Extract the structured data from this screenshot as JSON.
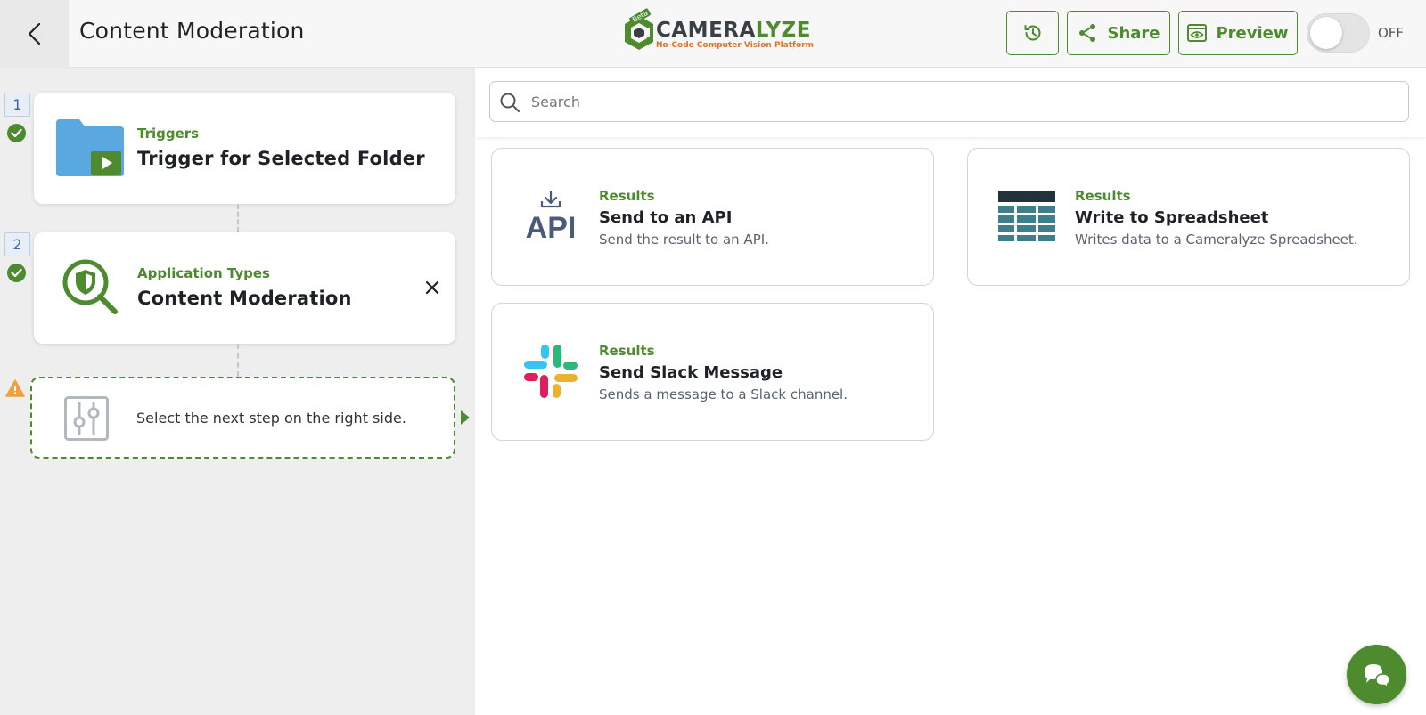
{
  "header": {
    "title": "Content Moderation",
    "logo": {
      "word_main": "CAMERA",
      "word_accent": "LYZE",
      "tagline": "No-Code Computer Vision Platform",
      "badge": "Beta"
    },
    "share_label": "Share",
    "preview_label": "Preview",
    "toggle_label": "OFF",
    "toggle_on": false
  },
  "steps": [
    {
      "number": "1",
      "category": "Triggers",
      "title": "Trigger for Selected Folder",
      "status": "complete"
    },
    {
      "number": "2",
      "category": "Application Types",
      "title": "Content Moderation",
      "status": "complete"
    }
  ],
  "pending_step": {
    "text": "Select the next step on the right side.",
    "status": "warning"
  },
  "search": {
    "placeholder": "Search",
    "value": ""
  },
  "results": [
    {
      "category": "Results",
      "title": "Send to an API",
      "description": "Send the result to an API.",
      "icon": "api-icon"
    },
    {
      "category": "Results",
      "title": "Write to Spreadsheet",
      "description": "Writes data to a Cameralyze Spreadsheet.",
      "icon": "spreadsheet-icon"
    },
    {
      "category": "Results",
      "title": "Send Slack Message",
      "description": "Sends a message to a Slack channel.",
      "icon": "slack-icon"
    }
  ],
  "icons": {
    "api_text": "API"
  },
  "colors": {
    "accent": "#4e8b2f",
    "text": "#1e2226",
    "muted": "#5a6270",
    "folder": "#5aa8e0",
    "spreadsheet": "#3f7f8c",
    "api": "#4b5a78"
  }
}
